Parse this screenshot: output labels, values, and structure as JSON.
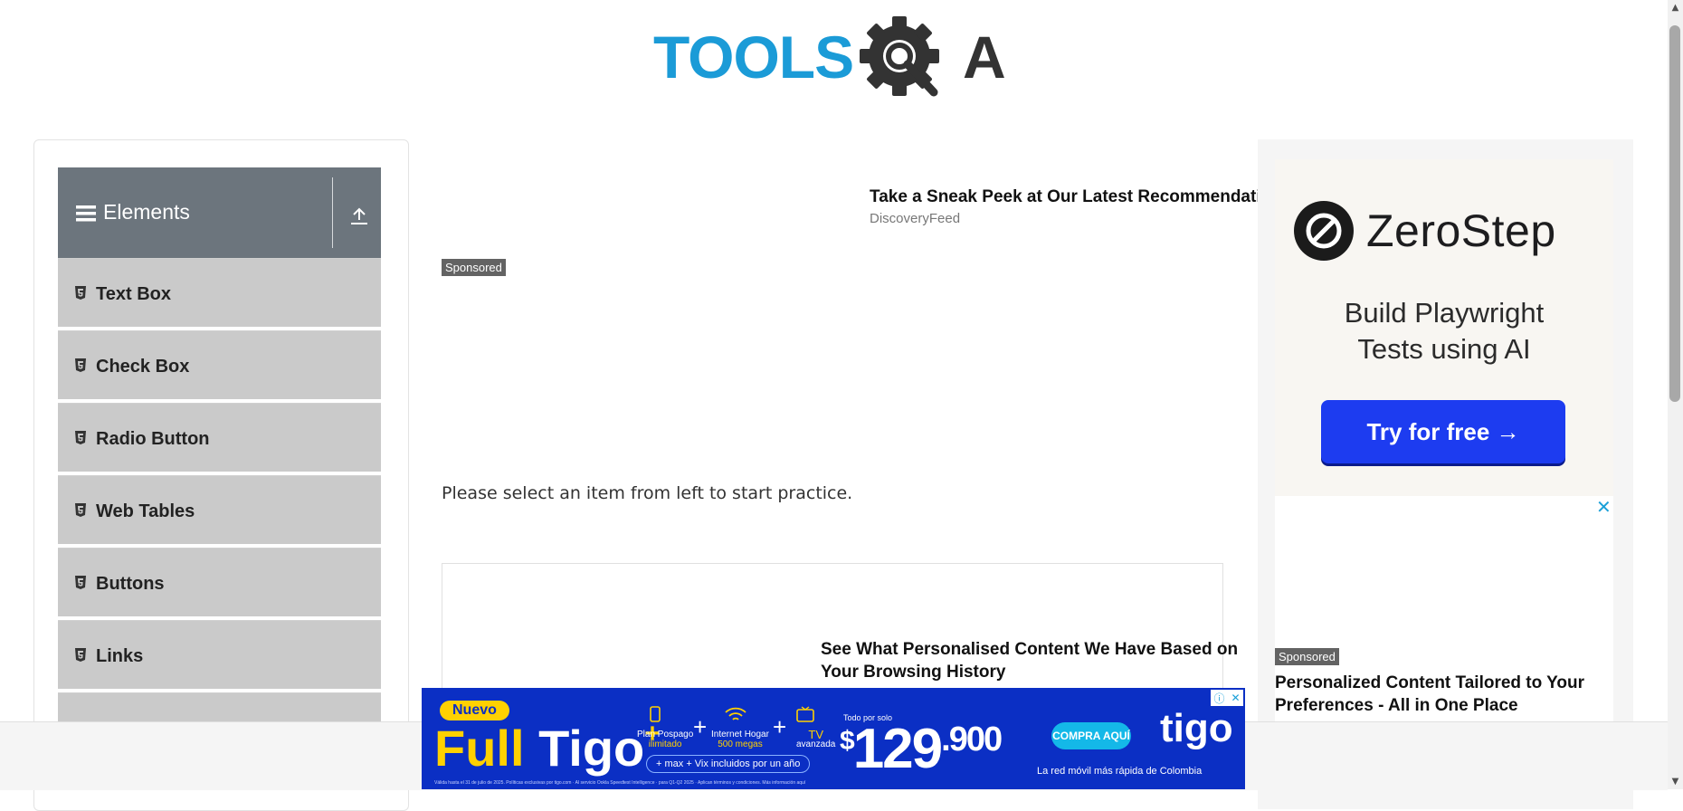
{
  "header": {
    "logo_text_left": "TOOLS",
    "logo_text_right": "A"
  },
  "sidebar": {
    "group_title": "Elements",
    "items": [
      {
        "label": "Text Box"
      },
      {
        "label": "Check Box"
      },
      {
        "label": "Radio Button"
      },
      {
        "label": "Web Tables"
      },
      {
        "label": "Buttons"
      },
      {
        "label": "Links"
      }
    ]
  },
  "main": {
    "instruction": "Please select an item from left to start practice.",
    "ad_top": {
      "title": "Take a Sneak Peek at Our Latest Recommendations",
      "source": "DiscoveryFeed",
      "sponsored": "Sponsored"
    },
    "ad_mid": {
      "title": "See What Personalised Content We Have Based on Your Browsing History"
    }
  },
  "right_ad": {
    "brand": "ZeroStep",
    "headline_line1": "Build Playwright",
    "headline_line2": "Tests using AI",
    "cta": "Try for free →",
    "close": "✕",
    "sponsored": "Sponsored",
    "title": "Personalized Content Tailored to Your Preferences - All in One Place"
  },
  "bottom_banner": {
    "badge": "Nuevo",
    "product_a": "Full",
    "product_b": "Tigo",
    "plus_sign": "+",
    "item1_line1": "Plan Pospago",
    "item1_line2": "ilimitado",
    "item2_line1": "Internet Hogar",
    "item2_line2": "500 megas",
    "item3_line1": "TV",
    "item3_line2": "avanzada",
    "included": "+ max  +  Vix  incluidos por un año",
    "todo": "Todo por solo",
    "price_currency": "$",
    "price_main": "129",
    "price_cents": ".900",
    "cta": "COMPRA AQUÍ",
    "logo": "tigo",
    "tagline": "La red móvil más rápida de Colombia",
    "fine_print": "Válida hasta el 31 de julio de 2025. Políticas exclusivas por tigo.com · Al servicio Ookla Speedtest Intelligence · para Q1-Q2 2025 · Aplican términos y condiciones. Más información aquí",
    "adchoice_info": "ⓘ",
    "adchoice_close": "✕"
  },
  "colors": {
    "accent_blue": "#1b9bd7",
    "group_header_bg": "#6c757d",
    "menu_item_bg": "#cacaca",
    "zerostep_cta": "#1d3cf0",
    "tigo_blue": "#0b2fc4",
    "tigo_yellow": "#ffd100"
  },
  "icons": {
    "hamburger": "bars-icon",
    "upload": "upload-icon",
    "item": "html5-icon"
  }
}
